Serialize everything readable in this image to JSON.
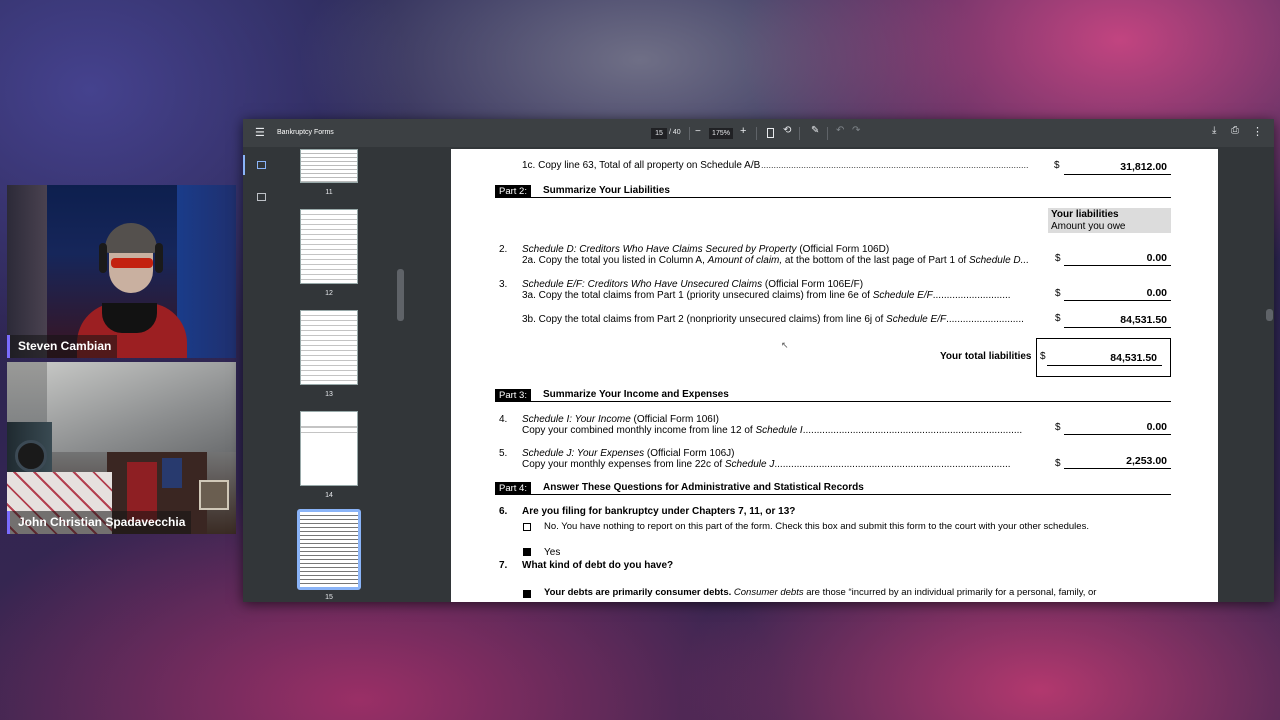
{
  "participants": [
    {
      "name": "Steven Cambian"
    },
    {
      "name": "John Christian Spadavecchia"
    }
  ],
  "viewer": {
    "title": "Bankruptcy Forms",
    "page_current": "15",
    "page_total": "/ 40",
    "zoom": "175%",
    "zoom_out": "−",
    "zoom_in": "+"
  },
  "thumbnails": [
    {
      "num": "11"
    },
    {
      "num": "12"
    },
    {
      "num": "13"
    },
    {
      "num": "14"
    },
    {
      "num": "15"
    }
  ],
  "doc": {
    "line1c": {
      "text": "1c. Copy line 63, Total of all property on Schedule A/B",
      "dots": "...........................................................................................................",
      "dollar": "$",
      "amount": "31,812.00"
    },
    "part2": {
      "label": "Part 2:",
      "title": "Summarize Your Liabilities"
    },
    "col_header": {
      "title": "Your liabilities",
      "sub": "Amount you owe"
    },
    "line2": {
      "num": "2.",
      "head_italic": "Schedule D: Creditors Who Have Claims Secured by Property",
      "head_rest": " (Official Form 106D)",
      "sub_a": "2a. Copy the total you listed in Column A, ",
      "sub_b": "Amount of claim,",
      "sub_c": " at the bottom of the last page of Part 1 of ",
      "sub_d": "Schedule D...",
      "dollar": "$",
      "amount": "0.00"
    },
    "line3": {
      "num": "3.",
      "head_italic": "Schedule E/F: Creditors Who Have Unsecured Claims",
      "head_rest": " (Official Form 106E/F)",
      "sub_a": "3a. Copy  the total claims from Part 1 (priority unsecured claims) from line 6e of ",
      "sub_b": "Schedule E/F",
      "sub_c": "............................",
      "dollar": "$",
      "amount": "0.00"
    },
    "line3b": {
      "sub_a": "3b. Copy  the total claims from Part 2 (nonpriority unsecured claims) from line 6j of ",
      "sub_b": "Schedule E/F",
      "sub_c": "............................",
      "dollar": "$",
      "amount": "84,531.50"
    },
    "total": {
      "label": "Your total liabilities",
      "dollar": "$",
      "amount": "84,531.50"
    },
    "part3": {
      "label": "Part 3:",
      "title": "Summarize Your Income and Expenses"
    },
    "line4": {
      "num": "4.",
      "head_italic": "Schedule I: Your Income",
      "head_rest": " (Official Form 106I)",
      "sub_a": "Copy your combined monthly income from line 12 of ",
      "sub_b": "Schedule I",
      "sub_c": "...............................................................................",
      "dollar": "$",
      "amount": "0.00"
    },
    "line5": {
      "num": "5.",
      "head_italic": "Schedule J: Your Expenses",
      "head_rest": " (Official Form 106J)",
      "sub_a": "Copy your monthly expenses from line 22c of ",
      "sub_b": "Schedule J",
      "sub_c": ".....................................................................................",
      "dollar": "$",
      "amount": "2,253.00"
    },
    "part4": {
      "label": "Part 4:",
      "title": "Answer These Questions for Administrative and Statistical Records"
    },
    "q6": {
      "num": "6.",
      "text": "Are you filing for bankruptcy under Chapters 7, 11, or 13?",
      "opt_no": "No. You have nothing to report on this part of the form. Check this box and submit this form to the court with your other schedules.",
      "opt_yes": "Yes"
    },
    "q7": {
      "num": "7.",
      "text": "What kind of debt do you have?",
      "opt_a_bold": "Your debts are primarily consumer debts.",
      "opt_a_italic": " Consumer debts",
      "opt_a_rest": " are those “incurred by an individual primarily for a personal, family, or"
    }
  }
}
